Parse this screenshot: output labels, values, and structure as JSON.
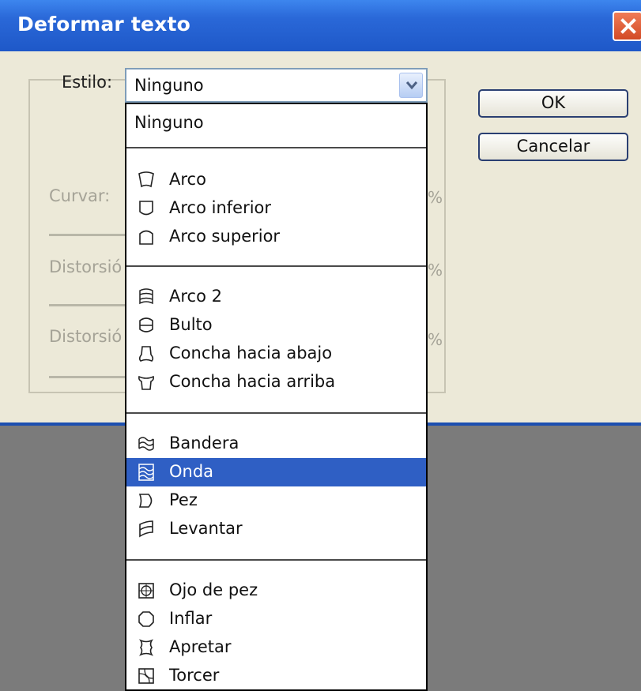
{
  "window": {
    "title": "Deformar texto"
  },
  "form": {
    "style_label": "Estilo:",
    "style_value": "Ninguno",
    "bend_label": "Curvar:",
    "h_distort_label": "Distorsió",
    "v_distort_label": "Distorsió",
    "percent": "%"
  },
  "buttons": {
    "ok": "OK",
    "cancel": "Cancelar"
  },
  "dropdown": {
    "selected": "Onda",
    "items": [
      {
        "label": "Ninguno",
        "icon": "none"
      },
      {
        "label": "Arco",
        "icon": "arc-icon"
      },
      {
        "label": "Arco inferior",
        "icon": "arc-lower-icon"
      },
      {
        "label": "Arco superior",
        "icon": "arc-upper-icon"
      },
      {
        "label": "Arco 2",
        "icon": "arch-icon"
      },
      {
        "label": "Bulto",
        "icon": "bulge-icon"
      },
      {
        "label": "Concha hacia abajo",
        "icon": "shell-lower-icon"
      },
      {
        "label": "Concha hacia arriba",
        "icon": "shell-upper-icon"
      },
      {
        "label": "Bandera",
        "icon": "flag-icon"
      },
      {
        "label": "Onda",
        "icon": "wave-icon"
      },
      {
        "label": "Pez",
        "icon": "fish-icon"
      },
      {
        "label": "Levantar",
        "icon": "rise-icon"
      },
      {
        "label": "Ojo de pez",
        "icon": "fisheye-icon"
      },
      {
        "label": "Inflar",
        "icon": "inflate-icon"
      },
      {
        "label": "Apretar",
        "icon": "squeeze-icon"
      },
      {
        "label": "Torcer",
        "icon": "twist-icon"
      }
    ]
  },
  "colors": {
    "title_bar": "#2a68d8",
    "selection": "#2f5fc4",
    "dialog_bg": "#ece9d8"
  }
}
